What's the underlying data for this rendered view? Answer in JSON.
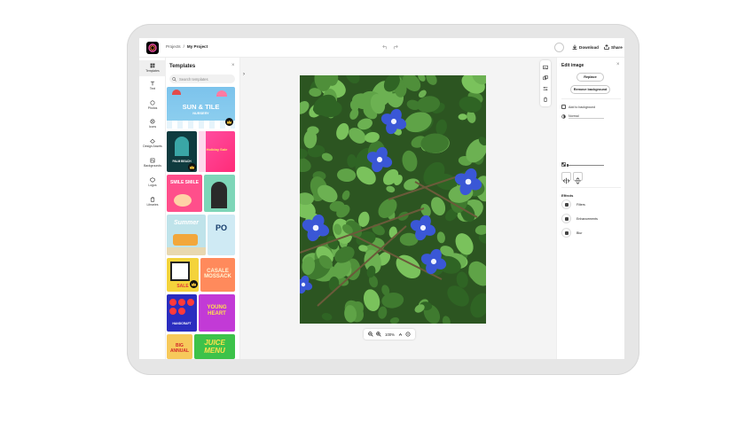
{
  "topbar": {
    "breadcrumb_root": "Projects",
    "breadcrumb_sep": "/",
    "breadcrumb_current": "My Project",
    "download_label": "Download",
    "share_label": "Share"
  },
  "rail": {
    "items": [
      {
        "label": "Templates",
        "icon": "templates-icon"
      },
      {
        "label": "Text",
        "icon": "text-icon"
      },
      {
        "label": "Photos",
        "icon": "photos-icon"
      },
      {
        "label": "Icons",
        "icon": "icons-icon"
      },
      {
        "label": "Design Assets",
        "icon": "design-assets-icon"
      },
      {
        "label": "Backgrounds",
        "icon": "backgrounds-icon"
      },
      {
        "label": "Logos",
        "icon": "logos-icon"
      },
      {
        "label": "Libraries",
        "icon": "libraries-icon"
      }
    ]
  },
  "templates_panel": {
    "title": "Templates",
    "close": "×",
    "search_placeholder": "Search templates",
    "thumbs": [
      {
        "title": "SUN & TILE",
        "sub": "NURSERY"
      },
      {
        "title": "PALM BEACH",
        "sub": ""
      },
      {
        "title": "Holiday Sale",
        "sub": ""
      },
      {
        "title": "SMILE SMILE",
        "sub": ""
      },
      {
        "title": "",
        "sub": ""
      },
      {
        "title": "Summer",
        "sub": ""
      },
      {
        "title": "PO",
        "sub": ""
      },
      {
        "title": "SALE",
        "sub": ""
      },
      {
        "title": "CASALE MOSSACK",
        "sub": ""
      },
      {
        "title": "HANDCRAFT",
        "sub": ""
      },
      {
        "title": "YOUNG HEART",
        "sub": ""
      },
      {
        "title": "BIG ANNUAL",
        "sub": ""
      },
      {
        "title": "JUICE MENU",
        "sub": ""
      }
    ]
  },
  "canvas": {
    "zoom_out": "−",
    "zoom_in": "+",
    "zoom_level": "100%",
    "chevron": "^"
  },
  "edit_panel": {
    "title": "Edit image",
    "close": "×",
    "replace_label": "Replace",
    "remove_bg_label": "Remove background",
    "add_to_bg_label": "Add to background",
    "blend_label": "Normal",
    "effects_title": "Effects",
    "effects": [
      "Filters",
      "Enhancements",
      "Blur"
    ]
  },
  "colors": {
    "accent": "#000000",
    "photo_bg": "#2f5a23",
    "flower": "#3a57d6"
  }
}
